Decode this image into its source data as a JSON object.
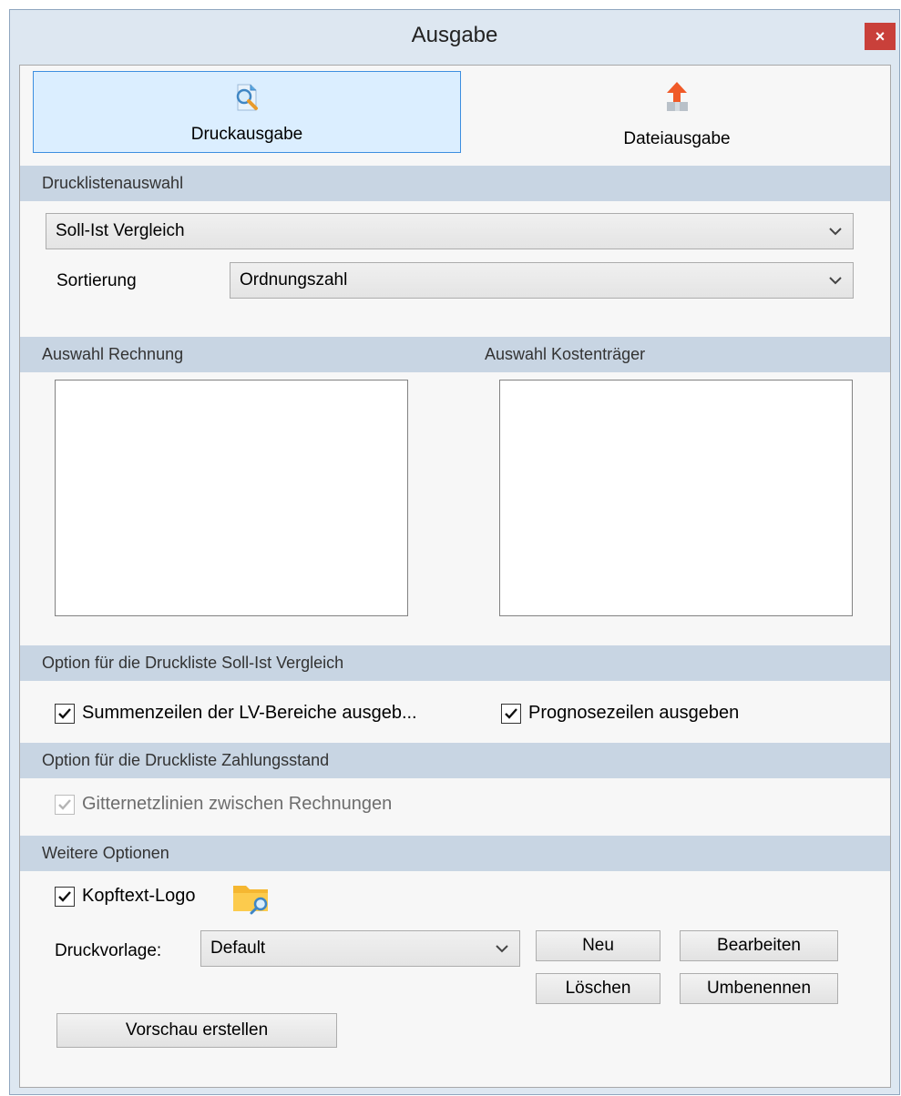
{
  "window": {
    "title": "Ausgabe",
    "close_label": "×"
  },
  "modes": {
    "print_label": "Druckausgabe",
    "file_label": "Dateiausgabe"
  },
  "sections": {
    "print_list": "Drucklistenauswahl",
    "invoice_selection": "Auswahl Rechnung",
    "cost_unit_selection": "Auswahl Kostenträger",
    "option_soll_ist": "Option für die Druckliste Soll-Ist Vergleich",
    "option_payment": "Option für die Druckliste Zahlungsstand",
    "more_options": "Weitere Optionen"
  },
  "print_list": {
    "selected": "Soll-Ist Vergleich",
    "sort_label": "Sortierung",
    "sort_value": "Ordnungszahl"
  },
  "options": {
    "sum_rows_label": "Summenzeilen der LV-Bereiche ausgeb...",
    "sum_rows_checked": true,
    "forecast_label": "Prognosezeilen ausgeben",
    "forecast_checked": true,
    "grid_lines_label": "Gitternetzlinien zwischen Rechnungen",
    "grid_lines_checked": true,
    "grid_lines_enabled": false,
    "header_logo_label": "Kopftext-Logo",
    "header_logo_checked": true
  },
  "template": {
    "label": "Druckvorlage:",
    "value": "Default",
    "new_label": "Neu",
    "edit_label": "Bearbeiten",
    "delete_label": "Löschen",
    "rename_label": "Umbenennen"
  },
  "preview_label": "Vorschau erstellen",
  "icons": {
    "print": "print-preview-icon",
    "file": "file-export-icon",
    "folder": "folder-search-icon",
    "close": "close-icon"
  },
  "colors": {
    "titlebar": "#dde7f1",
    "section_header": "#c8d5e3",
    "active_tab": "#dbeeff",
    "active_border": "#3d8ee0",
    "close": "#c9403a",
    "export_arrow": "#f05a28"
  }
}
